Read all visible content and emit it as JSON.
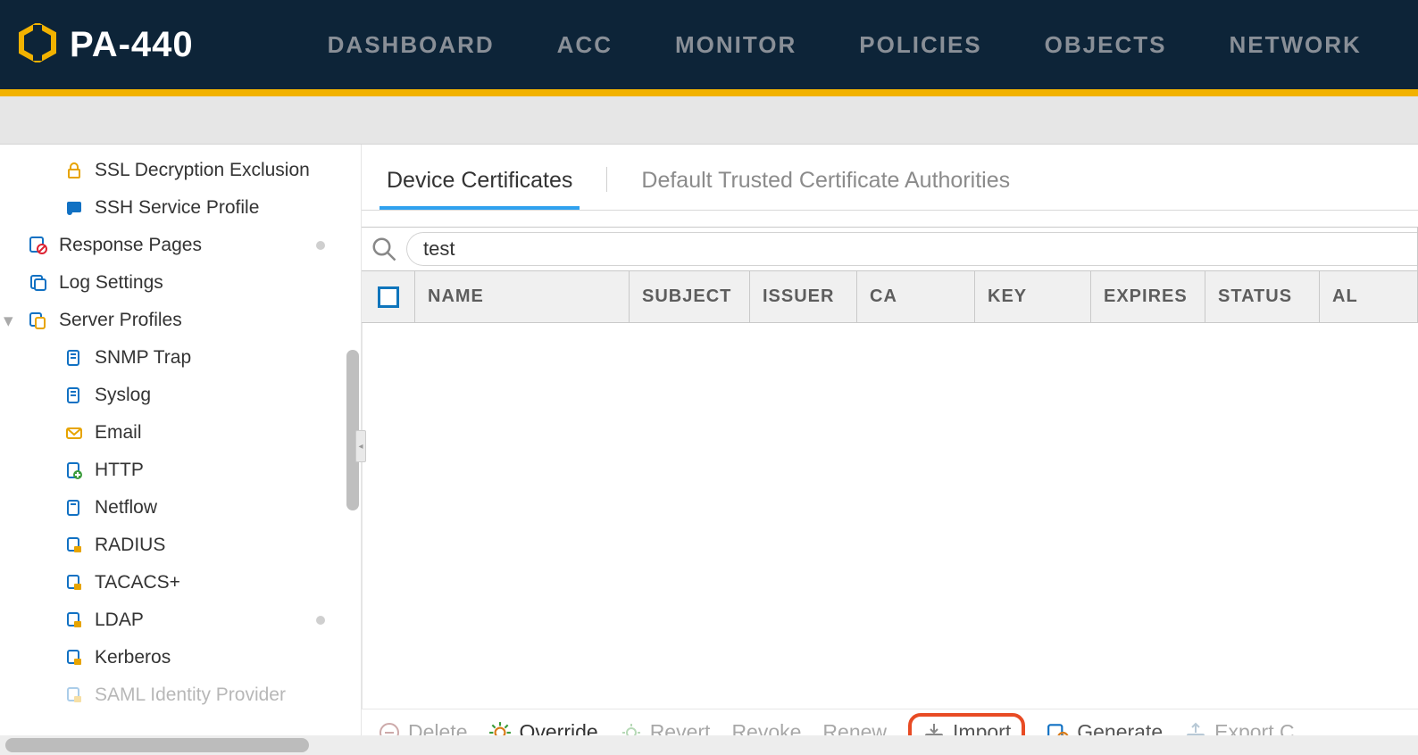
{
  "brand": {
    "model": "PA-440"
  },
  "nav": {
    "dashboard": "DASHBOARD",
    "acc": "ACC",
    "monitor": "MONITOR",
    "policies": "POLICIES",
    "objects": "OBJECTS",
    "network": "NETWORK"
  },
  "sidebar": {
    "ssl_decryption_exclusion": "SSL Decryption Exclusion",
    "ssh_service_profile": "SSH Service Profile",
    "response_pages": "Response Pages",
    "log_settings": "Log Settings",
    "server_profiles": "Server Profiles",
    "snmp_trap": "SNMP Trap",
    "syslog": "Syslog",
    "email": "Email",
    "http": "HTTP",
    "netflow": "Netflow",
    "radius": "RADIUS",
    "tacacs": "TACACS+",
    "ldap": "LDAP",
    "kerberos": "Kerberos",
    "saml": "SAML Identity Provider"
  },
  "tabs": {
    "device_certs": "Device Certificates",
    "default_trusted": "Default Trusted Certificate Authorities"
  },
  "search": {
    "value": "test"
  },
  "columns": {
    "name": "NAME",
    "subject": "SUBJECT",
    "issuer": "ISSUER",
    "ca": "CA",
    "key": "KEY",
    "expires": "EXPIRES",
    "status": "STATUS",
    "algorithm_partial": "AL"
  },
  "footer": {
    "delete": "Delete",
    "override": "Override",
    "revert": "Revert",
    "revoke": "Revoke",
    "renew": "Renew",
    "import": "Import",
    "generate": "Generate",
    "export_partial": "Export C"
  }
}
